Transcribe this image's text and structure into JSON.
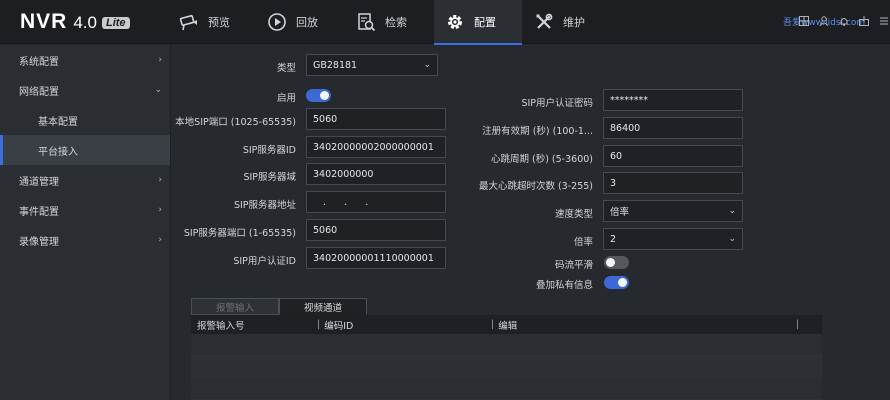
{
  "logo": {
    "name": "NVR",
    "version": "4.0",
    "edition": "Lite"
  },
  "nav": {
    "tabs": [
      {
        "label": "预览",
        "icon": "camera-icon"
      },
      {
        "label": "回放",
        "icon": "playback-icon"
      },
      {
        "label": "检索",
        "icon": "search-file-icon"
      },
      {
        "label": "配置",
        "icon": "gear-icon",
        "active": true
      },
      {
        "label": "维护",
        "icon": "wrench-icon"
      }
    ]
  },
  "watermark": "吾爱www.lidsi.com",
  "sidebar": {
    "items": [
      {
        "label": "系统配置",
        "chevron": "›"
      },
      {
        "label": "网络配置",
        "chevron": "⌄"
      },
      {
        "label": "基本配置"
      },
      {
        "label": "平台接入",
        "active": true
      },
      {
        "label": "通道管理",
        "chevron": "›"
      },
      {
        "label": "事件配置",
        "chevron": "›"
      },
      {
        "label": "录像管理",
        "chevron": "›"
      }
    ]
  },
  "form_left": {
    "type": {
      "label": "类型",
      "value": "GB28181"
    },
    "enable": {
      "label": "启用",
      "on": true
    },
    "local_sip_port": {
      "label": "本地SIP端口 (1025-65535)",
      "value": "5060"
    },
    "sip_server_id": {
      "label": "SIP服务器ID",
      "value": "34020000002000000001"
    },
    "sip_server_domain": {
      "label": "SIP服务器域",
      "value": "3402000000"
    },
    "sip_server_addr": {
      "label": "SIP服务器地址",
      "value": ".      .      .      "
    },
    "sip_server_port": {
      "label": "SIP服务器端口 (1-65535)",
      "value": "5060"
    },
    "sip_user_id": {
      "label": "SIP用户认证ID",
      "value": "34020000001110000001"
    }
  },
  "form_right": {
    "sip_password": {
      "label": "SIP用户认证密码",
      "value": "********"
    },
    "reg_validity": {
      "label": "注册有效期 (秒) (100-1...",
      "value": "86400"
    },
    "heartbeat": {
      "label": "心跳周期 (秒) (5-3600)",
      "value": "60"
    },
    "max_timeout": {
      "label": "最大心跳超时次数 (3-255)",
      "value": "3"
    },
    "speed_type": {
      "label": "速度类型",
      "value": "倍率"
    },
    "rate": {
      "label": "倍率",
      "value": "2"
    },
    "stream_smooth": {
      "label": "码流平滑",
      "on": false
    },
    "overlay_private": {
      "label": "叠加私有信息",
      "on": true
    }
  },
  "subtabs": [
    {
      "label": "报警输入",
      "active": false
    },
    {
      "label": "视频通道",
      "active": true
    }
  ],
  "table": {
    "columns": [
      "报警输入号",
      "编码ID",
      "编辑"
    ],
    "rows": []
  },
  "colors": {
    "accent": "#3a6fe0",
    "background": "#26292e",
    "topbar": "#1c1e22"
  }
}
